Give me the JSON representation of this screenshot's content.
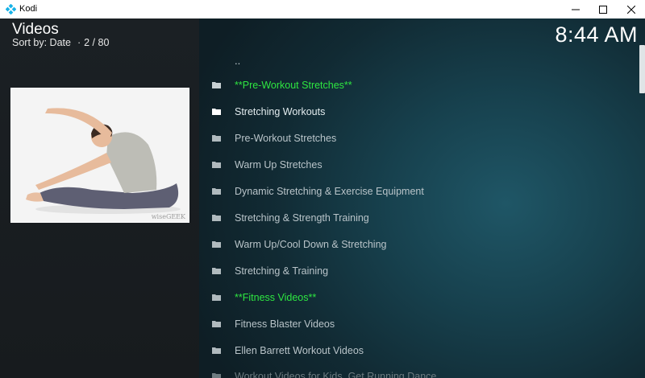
{
  "window": {
    "title": "Kodi",
    "buttons": {
      "minimize": "minimize",
      "maximize": "maximize",
      "close": "close"
    }
  },
  "header": {
    "title": "Videos",
    "sort_label": "Sort by: Date",
    "position": "2 / 80",
    "clock": "8:44 AM"
  },
  "thumbnail": {
    "watermark": "wiseGEEK"
  },
  "list": {
    "parent": "..",
    "items": [
      {
        "label": "**Pre-Workout Stretches**",
        "style": "highlight"
      },
      {
        "label": "Stretching Workouts",
        "style": "selected"
      },
      {
        "label": "Pre-Workout Stretches",
        "style": "normal"
      },
      {
        "label": "Warm Up Stretches",
        "style": "normal"
      },
      {
        "label": "Dynamic Stretching & Exercise Equipment",
        "style": "normal"
      },
      {
        "label": "Stretching & Strength Training",
        "style": "normal"
      },
      {
        "label": "Warm Up/Cool Down & Stretching",
        "style": "normal"
      },
      {
        "label": "Stretching & Training",
        "style": "normal"
      },
      {
        "label": "**Fitness Videos**",
        "style": "highlight"
      },
      {
        "label": "Fitness Blaster Videos",
        "style": "normal"
      },
      {
        "label": "Ellen Barrett Workout Videos",
        "style": "normal"
      },
      {
        "label": "Workout Videos for Kids, Get Running Dance",
        "style": "faded"
      }
    ]
  },
  "colors": {
    "highlight": "#2ee641",
    "text": "#b9c4c9",
    "accent_bg": "#1f5666"
  }
}
